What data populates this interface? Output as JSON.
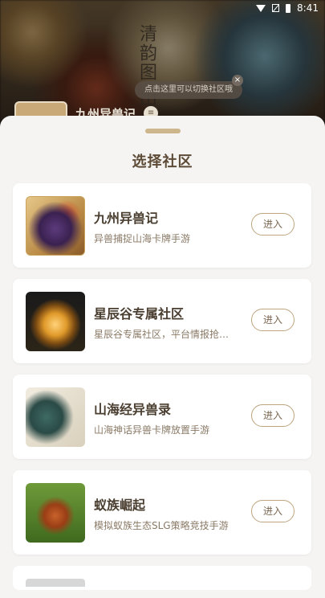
{
  "status_bar": {
    "time": "8:41"
  },
  "background": {
    "calligraphy": "清韵图 山海",
    "tooltip": "点击这里可以切换社区哦",
    "header_title": "九州异兽记"
  },
  "sheet": {
    "title": "选择社区",
    "communities": [
      {
        "name": "九州异兽记",
        "desc": "异兽捕捉山海卡牌手游",
        "button": "进入"
      },
      {
        "name": "星辰谷专属社区",
        "desc": "星辰谷专属社区，平台情报抢…",
        "button": "进入"
      },
      {
        "name": "山海经异兽录",
        "desc": "山海神话异兽卡牌放置手游",
        "button": "进入"
      },
      {
        "name": "蚁族崛起",
        "desc": "模拟蚁族生态SLG策略竞技手游",
        "button": "进入"
      }
    ]
  }
}
